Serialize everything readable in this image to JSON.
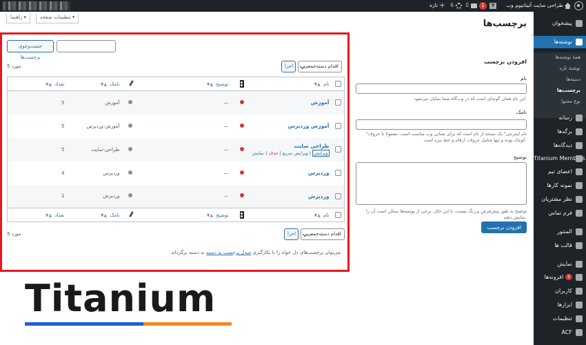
{
  "adminbar": {
    "site_name": "طراحی سایت آتیتانیوم وب",
    "notifications": "1",
    "comments_count": "0",
    "updates_count": "6",
    "new_label": "تازه"
  },
  "sidebar": {
    "items": [
      {
        "label": "پیشخوان",
        "icon": "dashboard-icon"
      },
      {
        "label": "نوشته‌ها",
        "icon": "pin-icon"
      },
      {
        "label": "رسانه",
        "icon": "media-icon"
      },
      {
        "label": "برگه‌ها",
        "icon": "pages-icon"
      },
      {
        "label": "دیدگاه‌ها",
        "icon": "comments-icon"
      },
      {
        "label": "Titanium Members",
        "icon": "members-icon"
      },
      {
        "label": "اعضای تیم",
        "icon": "team-icon"
      },
      {
        "label": "نمونه کارها",
        "icon": "portfolio-icon"
      },
      {
        "label": "نظر مشتریان",
        "icon": "testimonial-icon"
      },
      {
        "label": "فرم تماس",
        "icon": "mail-icon"
      },
      {
        "label": "المنتور",
        "icon": "elementor-icon"
      },
      {
        "label": "قالب ها",
        "icon": "template-icon"
      },
      {
        "label": "نمایش",
        "icon": "appearance-icon"
      },
      {
        "label": "افزونه‌ها",
        "icon": "plugins-icon",
        "badge": "5"
      },
      {
        "label": "کاربران",
        "icon": "users-icon"
      },
      {
        "label": "ابزارها",
        "icon": "tools-icon"
      },
      {
        "label": "تنظیمات",
        "icon": "settings-icon"
      },
      {
        "label": "ACF",
        "icon": "acf-icon"
      }
    ],
    "submenu": [
      "همهٔ نوشته‌ها",
      "نوشتهٔ تازه",
      "دسته‌ها",
      "برچسب‌ها",
      "نوع محتوا"
    ]
  },
  "header": {
    "title": "برچسب‌ها",
    "screen_options": "تنظیمات صفحه",
    "help": "راهنما"
  },
  "add_form": {
    "heading": "افزودن برچسب",
    "name_label": "نام",
    "name_desc": "این نام همان گونه‌ای است که در وب‌گاه شما نمایان می‌شود.",
    "slug_label": "نامک",
    "slug_desc": "\"نام اینترنتی\" یک نسخه از نام است که برای نشانی وب مناسب است. معمولا با حروف کوچک بوده و تنها شامل حروف، ارقام و خط تیره است.",
    "desc_label": "توضیح",
    "desc_desc": "توضیح به طور پیش‌فرض پررنگ نیست، با این حال، برخی از پوسته‌ها ممکن است آن را نمایش دهند.",
    "submit": "افزودن برچسب"
  },
  "list": {
    "search_button": "جست‌وجوی برچسب‌ها",
    "bulk_action": "اقدام دسته‌جمعی",
    "apply": "اجرا",
    "items_count": "5 مورد",
    "columns": {
      "name": "نام",
      "description": "توضیح",
      "slug": "نامک",
      "count": "تعداد"
    },
    "rows": [
      {
        "name": "آموزش",
        "desc": "—",
        "slug": "آموزش",
        "count": "5"
      },
      {
        "name": "آموزش وردپرس",
        "desc": "—",
        "slug": "آموزش-وردپرس",
        "count": "5"
      },
      {
        "name": "طراحی سایت",
        "desc": "—",
        "slug": "طراحی-سایت",
        "count": "5"
      },
      {
        "name": "وردپرس",
        "desc": "—",
        "slug": "وردپرس",
        "count": "4"
      },
      {
        "name": "ورد‌پرش",
        "desc": "—",
        "slug": "وردپرش",
        "count": "1"
      }
    ],
    "row_actions": {
      "edit": "ویرایش",
      "quick": "ویرایش سریع",
      "delete": "حذف",
      "view": "نمایش"
    },
    "note_prefix": "می‌توان برچسب‌های دل خواه را با بکارگیری",
    "note_link": "مبدل برچسب به دسته",
    "note_suffix": "به دسته برگرداند."
  },
  "logo": {
    "text": "Titanium",
    "bar_colors": [
      "#1e5fd8",
      "#f08a1c"
    ]
  },
  "colors": {
    "accent": "#2271b1",
    "sidebar": "#1d2327",
    "highlight_border": "#e5191e"
  }
}
